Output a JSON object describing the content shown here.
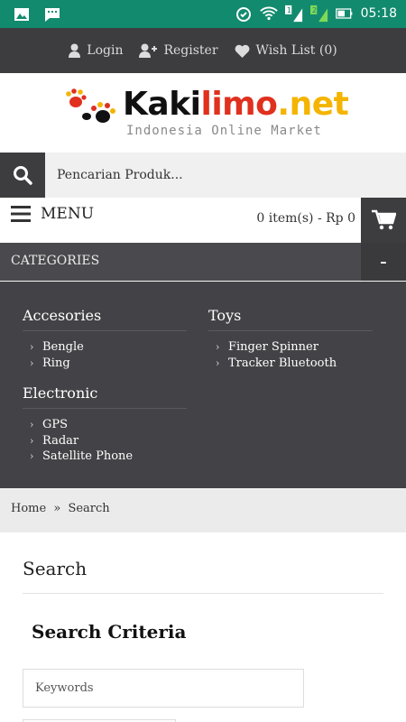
{
  "status_bar": {
    "time": "05:18",
    "icons": [
      "gallery-icon",
      "chat-icon",
      "alarm-icon",
      "wifi-icon",
      "signal-sim1-icon",
      "signal-sim2-icon",
      "battery-icon"
    ],
    "sim1": "1",
    "sim2": "2",
    "color": "#128a6e"
  },
  "top_bar": {
    "login": "Login",
    "register": "Register",
    "wishlist": "Wish List (0)"
  },
  "logo": {
    "brand_main": "Kaki",
    "brand_accent": "limo",
    "brand_suffix": ".net",
    "tagline": "Indonesia Online Market"
  },
  "search": {
    "placeholder": "Pencarian Produk..."
  },
  "menu": {
    "label": "MENU",
    "cart_summary": "0 item(s) - Rp 0"
  },
  "categories": {
    "title": "CATEGORIES",
    "toggle": "-",
    "groups": [
      {
        "name": "Accesories",
        "items": [
          "Bengle",
          "Ring"
        ]
      },
      {
        "name": "Electronic",
        "items": [
          "GPS",
          "Radar",
          "Satellite Phone"
        ]
      },
      {
        "name": "Toys",
        "items": [
          "Finger Spinner",
          "Tracker Bluetooth"
        ]
      }
    ]
  },
  "breadcrumb": {
    "home": "Home",
    "separator": "»",
    "current": "Search"
  },
  "content": {
    "page_title": "Search",
    "criteria_title": "Search Criteria",
    "keywords_placeholder": "Keywords"
  },
  "colors": {
    "dark": "#3d3d40",
    "panel": "#434347",
    "accent": "#f4b400"
  }
}
